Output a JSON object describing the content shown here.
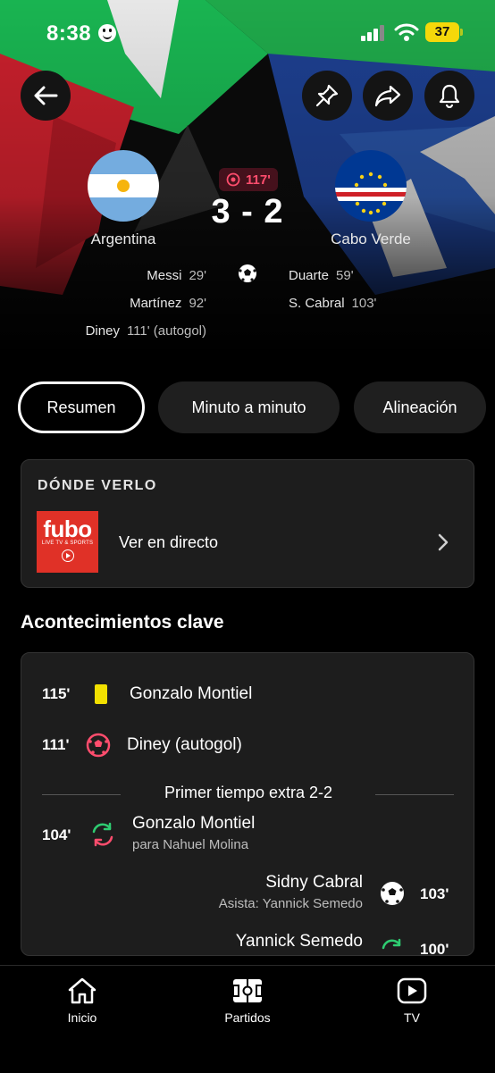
{
  "status_bar": {
    "time": "8:38",
    "battery": "37"
  },
  "match": {
    "minute": "117'",
    "score": "3 - 2",
    "home": {
      "name": "Argentina"
    },
    "away": {
      "name": "Cabo Verde"
    },
    "home_scorers": [
      {
        "name": "Messi",
        "minute": "29'"
      },
      {
        "name": "Martínez",
        "minute": "92'"
      },
      {
        "name": "Diney",
        "minute": "111' (autogol)"
      }
    ],
    "away_scorers": [
      {
        "name": "Duarte",
        "minute": "59'"
      },
      {
        "name": "S. Cabral",
        "minute": "103'"
      }
    ]
  },
  "tabs": [
    "Resumen",
    "Minuto a minuto",
    "Alineación"
  ],
  "where_to_watch": {
    "title": "DÓNDE VERLO",
    "provider_logo_text": "fubo",
    "provider_tagline": "LIVE TV & SPORTS",
    "action_label": "Ver en directo"
  },
  "key_events": {
    "title": "Acontecimientos clave",
    "events": [
      {
        "minute": "115'",
        "type": "yellow-card",
        "name": "Gonzalo Montiel"
      },
      {
        "minute": "111'",
        "type": "own-goal",
        "name": "Diney (autogol)"
      },
      {
        "minute": "104'",
        "type": "substitution",
        "name": "Gonzalo Montiel",
        "sub": "para Nahuel Molina"
      },
      {
        "minute": "103'",
        "type": "goal",
        "name": "Sidny Cabral",
        "sub": "Asista: Yannick Semedo"
      },
      {
        "minute": "100'",
        "type": "substitution",
        "name": "Yannick Semedo"
      }
    ],
    "period_label": "Primer tiempo extra 2-2"
  },
  "bottom_nav": [
    "Inicio",
    "Partidos",
    "TV"
  ],
  "colors": {
    "accent_red": "#ff4d6d",
    "background": "#000000",
    "card": "#1d1d1d",
    "yellow_card": "#f2e000"
  }
}
